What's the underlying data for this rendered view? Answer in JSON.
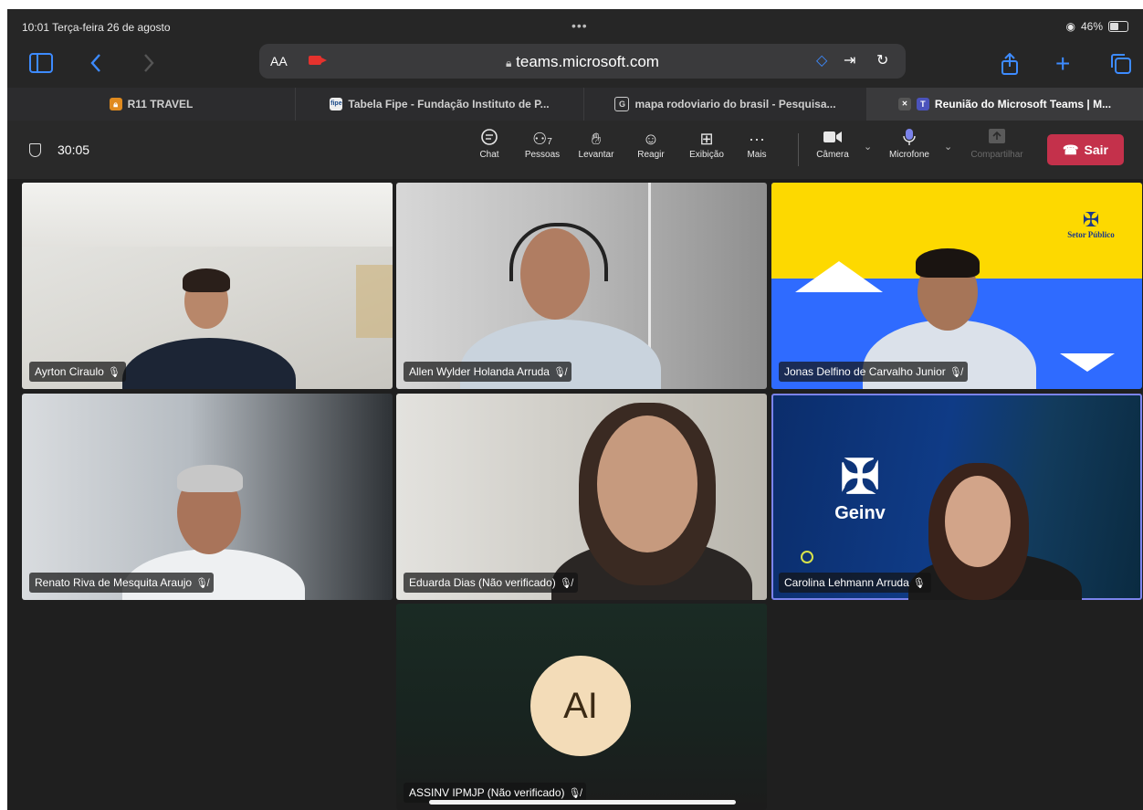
{
  "status_bar": {
    "time_date": "10:01  Terça-feira 26 de agosto",
    "dots": "•••",
    "battery": "46%"
  },
  "toolbar": {
    "aa": "AA",
    "url": "teams.microsoft.com"
  },
  "tabs": [
    {
      "label": "R11 TRAVEL",
      "favicon": "lock-icon"
    },
    {
      "label": "Tabela Fipe - Fundação Instituto de P...",
      "favicon": "fipe"
    },
    {
      "label": "mapa rodoviario do brasil - Pesquisa...",
      "favicon": "G"
    },
    {
      "label": "Reunião do Microsoft Teams | M...",
      "favicon": "T"
    }
  ],
  "meeting": {
    "timer": "30:05",
    "people_count": "7",
    "controls": {
      "chat": "Chat",
      "people": "Pessoas",
      "raise": "Levantar",
      "react": "Reagir",
      "view": "Exibição",
      "more": "Mais",
      "camera": "Câmera",
      "microphone": "Microfone",
      "share": "Compartilhar",
      "leave": "Sair"
    }
  },
  "participants": [
    {
      "name": "Ayrton Ciraulo",
      "mic": "on"
    },
    {
      "name": "Allen Wylder Holanda Arruda",
      "mic": "muted"
    },
    {
      "name": "Jonas Delfino de Carvalho Junior",
      "mic": "muted"
    },
    {
      "name": "Renato Riva de Mesquita Araujo",
      "mic": "muted"
    },
    {
      "name": "Eduarda Dias (Não verificado)",
      "mic": "muted"
    },
    {
      "name": "Carolina Lehmann Arruda",
      "mic": "on",
      "speaking": true
    },
    {
      "name": "ASSINV IPMJP (Não verificado)",
      "mic": "muted",
      "initials": "AI"
    }
  ],
  "backgrounds": {
    "setor_publico": "Setor Público",
    "geinv": "Geinv"
  },
  "colors": {
    "accent": "#3d8bff",
    "leave": "#c4314b",
    "speaking": "#7b83eb",
    "yellow": "#fdd900",
    "blue": "#2f6bff"
  }
}
